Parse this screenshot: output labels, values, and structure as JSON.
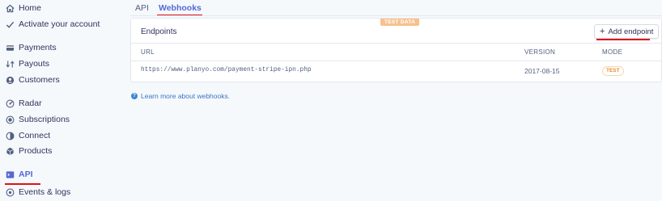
{
  "sidebar": {
    "items": [
      {
        "label": "Home",
        "icon": "home-icon"
      },
      {
        "label": "Activate your account",
        "icon": "check-icon"
      },
      {
        "label": "Payments",
        "icon": "payments-icon"
      },
      {
        "label": "Payouts",
        "icon": "payouts-icon"
      },
      {
        "label": "Customers",
        "icon": "customers-icon"
      },
      {
        "label": "Radar",
        "icon": "radar-icon"
      },
      {
        "label": "Subscriptions",
        "icon": "subscriptions-icon"
      },
      {
        "label": "Connect",
        "icon": "connect-icon"
      },
      {
        "label": "Products",
        "icon": "products-icon"
      },
      {
        "label": "API",
        "icon": "api-icon",
        "active": true
      },
      {
        "label": "Events & logs",
        "icon": "events-icon"
      }
    ]
  },
  "tabs": [
    {
      "label": "API",
      "active": false
    },
    {
      "label": "Webhooks",
      "active": true
    }
  ],
  "endpoints": {
    "badge": "TEST DATA",
    "title": "Endpoints",
    "add_button": "Add endpoint",
    "columns": {
      "url": "URL",
      "version": "VERSION",
      "mode": "MODE"
    },
    "rows": [
      {
        "url": "https://www.planyo.com/payment-stripe-ipn.php",
        "version": "2017-08-15",
        "mode": "TEST"
      }
    ]
  },
  "help": {
    "link": "Learn more about webhooks."
  },
  "colors": {
    "accent": "#5469d4",
    "annotation": "#e0101a",
    "test": "#f7c28d",
    "link": "#3a75c4"
  }
}
